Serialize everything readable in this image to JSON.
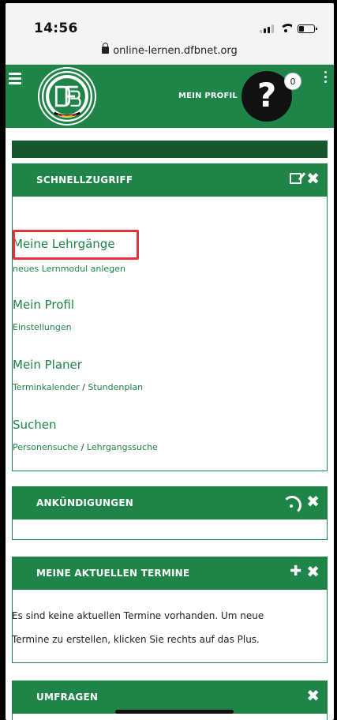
{
  "status_bar": {
    "time": "14:56",
    "url": "online-lernen.dfbnet.org"
  },
  "header": {
    "profile_label": "MEIN PROFIL",
    "notification_count": "0",
    "avatar_glyph": "?",
    "brand_color": "#1e8447"
  },
  "schnellzugriff": {
    "title": "SCHNELLZUGRIFF",
    "items": [
      {
        "label": "Meine Lehrgänge",
        "sub": [
          "neues Lernmodul anlegen"
        ]
      },
      {
        "label": "Mein Profil",
        "sub": [
          "Einstellungen"
        ]
      },
      {
        "label": "Mein Planer",
        "sub": [
          "Terminkalender",
          "Stundenplan"
        ]
      },
      {
        "label": "Suchen",
        "sub": [
          "Personensuche",
          "Lehrgangssuche"
        ]
      }
    ],
    "separator": "/"
  },
  "ankuendigungen": {
    "title": "ANKÜNDIGUNGEN"
  },
  "termine": {
    "title": "MEINE AKTUELLEN TERMINE",
    "line1": "Es sind keine aktuellen Termine vorhanden. Um neue",
    "line2": "Termine zu erstellen, klicken Sie rechts auf das Plus."
  },
  "umfragen": {
    "title": "UMFRAGEN"
  },
  "icons": {
    "close": "✖",
    "plus": "✚"
  }
}
